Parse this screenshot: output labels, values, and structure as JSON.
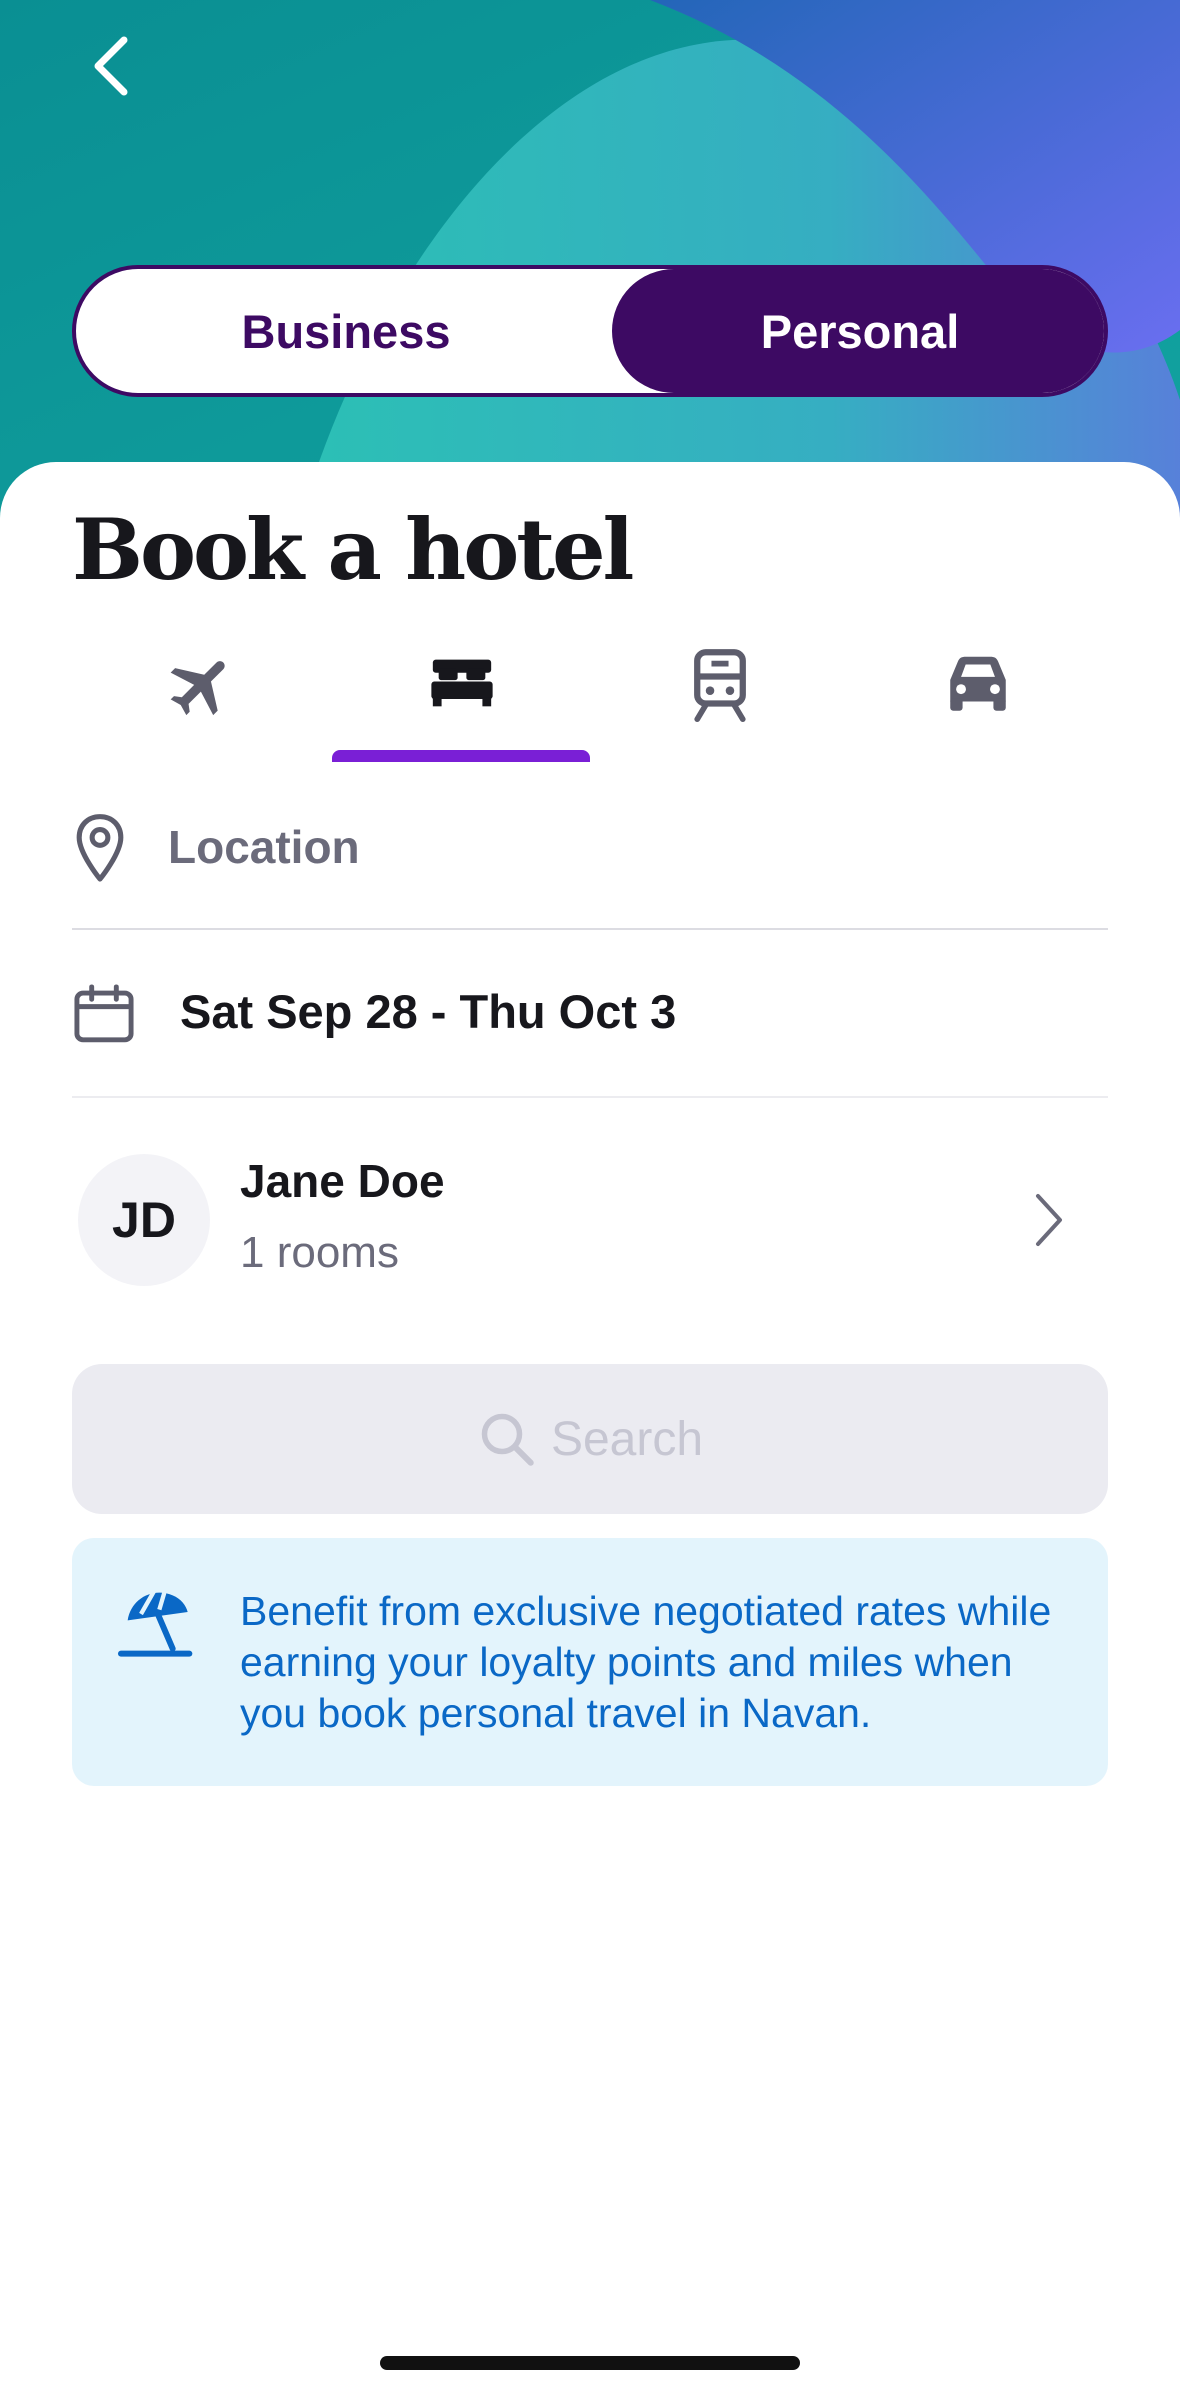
{
  "header": {
    "back_icon": "chevron-left-icon",
    "segments": [
      {
        "label": "Business",
        "selected": false
      },
      {
        "label": "Personal",
        "selected": true
      }
    ]
  },
  "page": {
    "title": "Book a hotel"
  },
  "tabs": [
    {
      "icon": "plane-icon",
      "selected": false
    },
    {
      "icon": "bed-icon",
      "selected": true
    },
    {
      "icon": "train-icon",
      "selected": false
    },
    {
      "icon": "car-icon",
      "selected": false
    }
  ],
  "form": {
    "location": {
      "icon": "map-pin-icon",
      "placeholder": "Location",
      "value": ""
    },
    "dates": {
      "icon": "calendar-icon",
      "value": "Sat Sep 28 - Thu Oct 3"
    },
    "traveler": {
      "initials": "JD",
      "name": "Jane Doe",
      "rooms": "1 rooms",
      "chevron_icon": "chevron-right-icon"
    },
    "search": {
      "icon": "search-icon",
      "label": "Search",
      "enabled": false
    }
  },
  "banner": {
    "icon": "beach-umbrella-icon",
    "text": "Benefit from exclusive negotiated rates while earning your loyalty points and miles when you book personal travel in Navan."
  },
  "colors": {
    "brand_purple": "#3d0a63",
    "tab_indicator": "#7a1fd6",
    "banner_bg": "#e3f4fc",
    "banner_text": "#0a68c6",
    "hero_teal": "#0f9a9c"
  }
}
